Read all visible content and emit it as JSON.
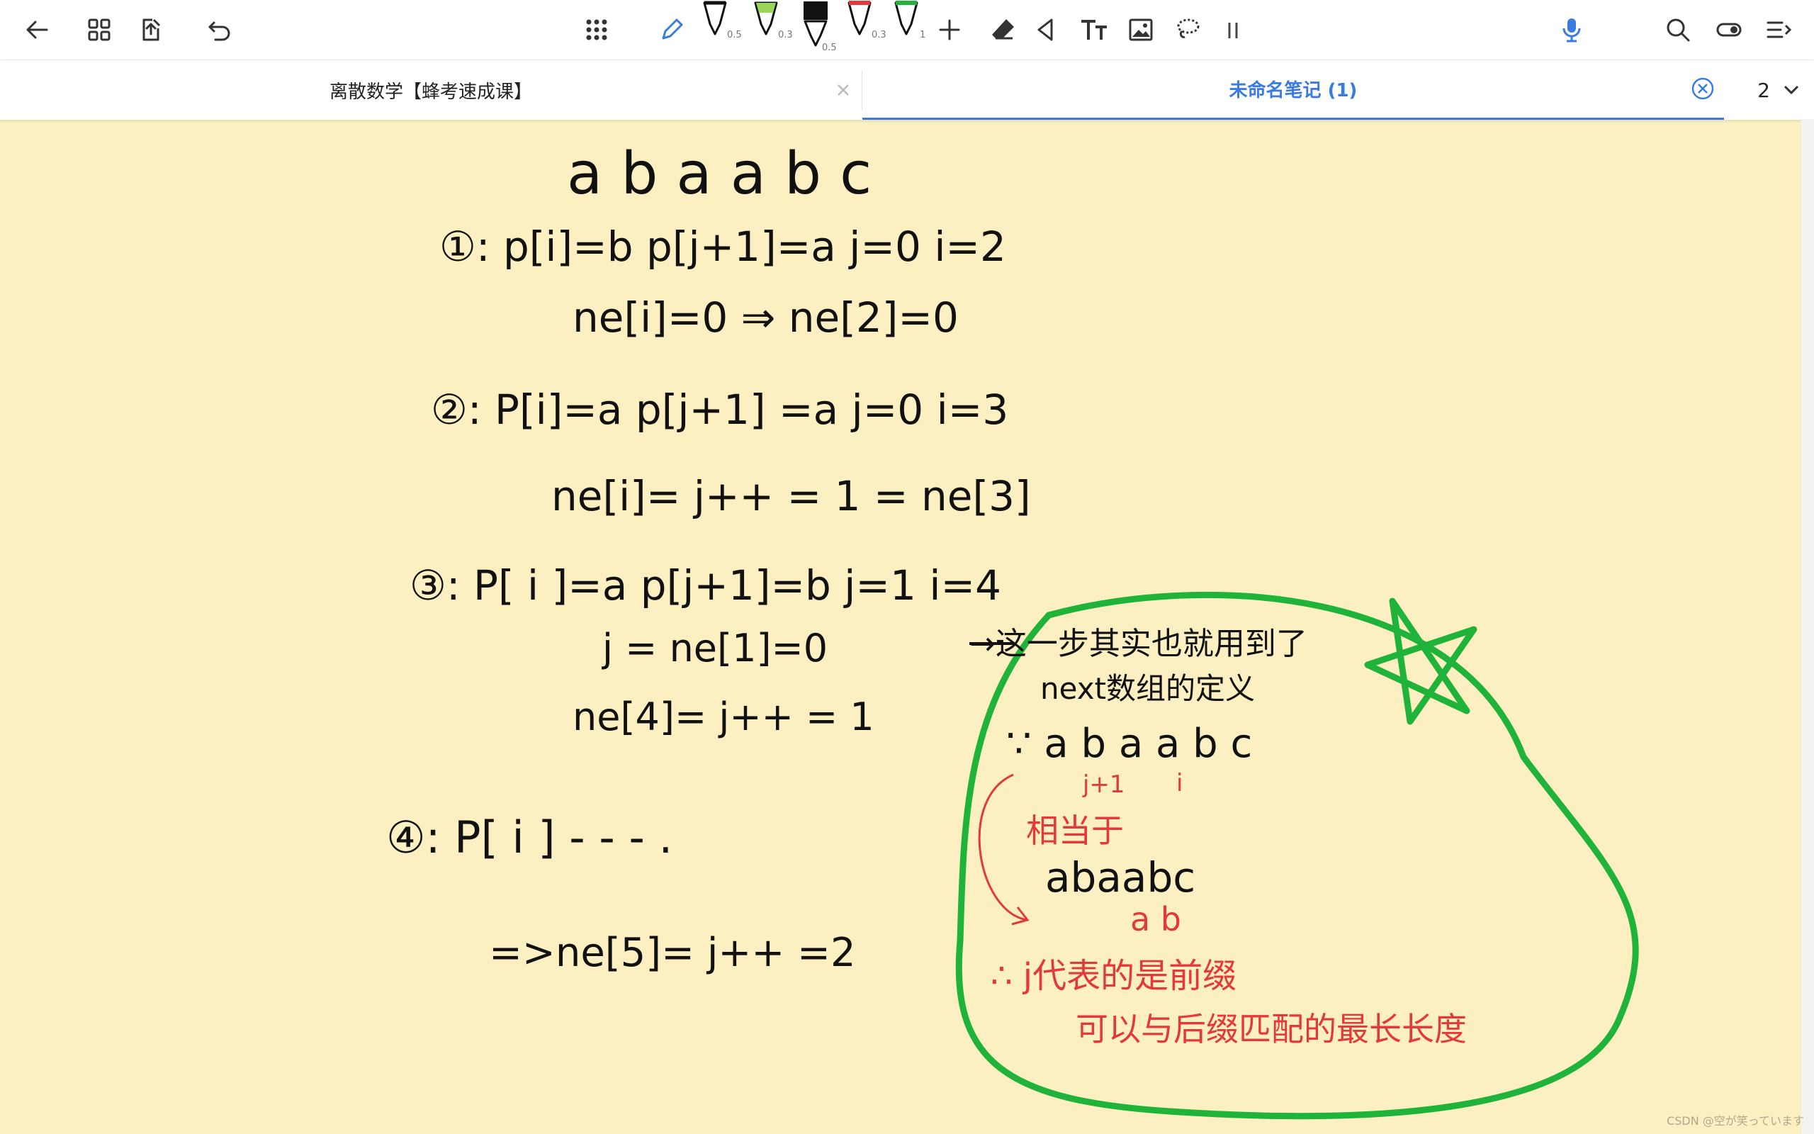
{
  "colors": {
    "toolbar_bg": "#ffffff",
    "canvas_bg": "#fcf0c2",
    "accent": "#3a7be0",
    "pen_black": "#111111",
    "pen_red": "#e23a3a",
    "pen_green": "#1fb33a",
    "highlight_green": "#9ad65a"
  },
  "toolbar": {
    "left_icons": [
      "back-arrow-icon",
      "grid-icon",
      "export-icon",
      "undo-icon"
    ],
    "center_icons": [
      "apps-icon",
      "pencil-icon",
      "pen-icon",
      "pen-icon",
      "pen-icon",
      "pen-icon",
      "pen-icon",
      "add-icon",
      "eraser-icon",
      "shape-icon",
      "text-icon",
      "image-icon",
      "lasso-icon",
      "pause-icon"
    ],
    "pens": [
      {
        "size": "0.5",
        "color": "#111111"
      },
      {
        "size": "0.3",
        "color": "#9ad65a"
      },
      {
        "size": "0.5",
        "color": "#111111"
      },
      {
        "size": "0.3",
        "color": "#e23a3a"
      },
      {
        "size": "1",
        "color": "#1fb33a"
      }
    ],
    "right_icons": [
      "microphone-icon",
      "search-icon",
      "toggle-icon",
      "menu-icon"
    ]
  },
  "tabs": [
    {
      "title": "离散数学【蜂考速成课】",
      "active": false
    },
    {
      "title": "未命名笔记 (1)",
      "active": true
    }
  ],
  "tab_count": "2",
  "note": {
    "black_lines": [
      "a b a a b c",
      "①: p[i]=b   p[j+1]=a   j=0  i=2",
      "ne[i]=0  ⇒ ne[2]=0",
      "②: P[i]=a   p[j+1] =a   j=0   i=3",
      "ne[i]= j++ = 1 = ne[3]",
      "③: P[ i ]=a   p[j+1]=b  j=1   i=4",
      "j = ne[1]=0",
      "ne[4]= j++ = 1",
      "④: P[ i ]  - - - .",
      "=>ne[5]= j++ =2"
    ],
    "side_note": [
      "→这一步其实也就用到了",
      "next数组的定义",
      "∵ a b a a b c",
      "abaabc",
      "a b"
    ],
    "red_notes": [
      "j+1",
      "i",
      "相当于",
      "∴ j代表的是前缀",
      "可以与后缀匹配的最长长度"
    ]
  },
  "watermark": "CSDN @空が笑っています"
}
